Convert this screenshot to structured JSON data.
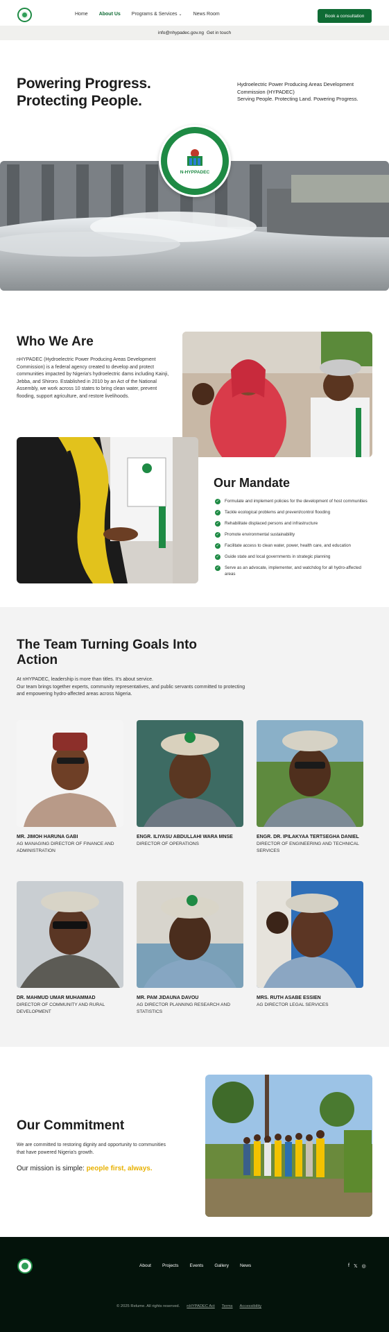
{
  "header": {
    "nav": [
      {
        "label": "Home",
        "active": false
      },
      {
        "label": "About Us",
        "active": true
      },
      {
        "label": "Programs & Services",
        "active": false,
        "dropdown": true
      },
      {
        "label": "News Room",
        "active": false
      }
    ],
    "cta": "Book a consultation"
  },
  "topbar": {
    "email": "info@nhypadec.gov.ng",
    "link": "Get in touch"
  },
  "hero": {
    "title_line1": "Powering Progress.",
    "title_line2": "Protecting People.",
    "description_line1": "Hydroelectric Power Producing Areas Development",
    "description_line2": "Commission (HYPADEC)",
    "tagline": "Serving People. Protecting Land. Powering Progress.",
    "badge_text": "N-HYPPADEC"
  },
  "who": {
    "title": "Who We Are",
    "text": "nHYPADEC (Hydroelectric Power Producing Areas Development Commission) is a federal agency created to develop and protect communities impacted by Nigeria's hydroelectric dams including Kainji, Jebba, and Shiroro. Established in 2010 by an Act of the National Assembly, we work across 10 states to bring clean water, prevent flooding, support agriculture, and restore livelihoods."
  },
  "mandate": {
    "title": "Our Mandate",
    "items": [
      "Formulate and implement policies for the development of host communities",
      "Tackle ecological problems and prevent/control flooding",
      "Rehabilitate displaced persons and infrastructure",
      "Promote environmental sustainability",
      "Facilitate access to clean water, power, health care, and education",
      "Guide state and local governments in strategic planning",
      "Serve as an advocate, implementer, and watchdog for all hydro-affected areas"
    ]
  },
  "team": {
    "title": "The Team Turning Goals Into Action",
    "subtitle_line1": "At nHYPADEC, leadership is more than titles. It's about service.",
    "subtitle_line2": "Our team brings together experts, community representatives, and public servants committed to protecting and empowering hydro-affected areas across Nigeria.",
    "members": [
      {
        "name": "MR. JIMOH HARUNA GABI",
        "role": "AG MANAGING DIRECTOR OF FINANCE AND ADMINISTRATION"
      },
      {
        "name": "ENGR. ILIYASU ABDULLAHI WARA MNSE",
        "role": "DIRECTOR OF OPERATIONS"
      },
      {
        "name": "ENGR. DR. IPILAKYAA TERTSEGHA DANIEL",
        "role": "DIRECTOR OF ENGINEERING AND TECHNICAL SERVICES"
      },
      {
        "name": "DR. MAHMUD UMAR MUHAMMAD",
        "role": "DIRECTOR OF COMMUNITY AND RURAL DEVELOPMENT"
      },
      {
        "name": "MR. PAM JIDAUNA DAVOU",
        "role": "AG DIRECTOR PLANNING RESEARCH AND STATISTICS"
      },
      {
        "name": "MRS. RUTH ASABE ESSIEN",
        "role": "AG DIRECTOR LEGAL SERVICES"
      }
    ]
  },
  "commitment": {
    "title": "Our Commitment",
    "text": "We are committed to restoring dignity and opportunity to communities that have powered Nigeria's growth.",
    "mission_prefix": "Our mission is simple: ",
    "mission_highlight": "people first, always."
  },
  "footer": {
    "links": [
      "About",
      "Projects",
      "Events",
      "Gallery",
      "News"
    ],
    "social": [
      "facebook-icon",
      "x-icon",
      "instagram-icon"
    ],
    "copyright": "© 2025 Relume. All rights reserved.",
    "bottom_links": [
      "nHYPADEC Act",
      "Terms",
      "Accessibility"
    ]
  },
  "colors": {
    "brand_green": "#0f6b34",
    "accent_yellow": "#e8b100",
    "footer_bg": "#04130b"
  }
}
